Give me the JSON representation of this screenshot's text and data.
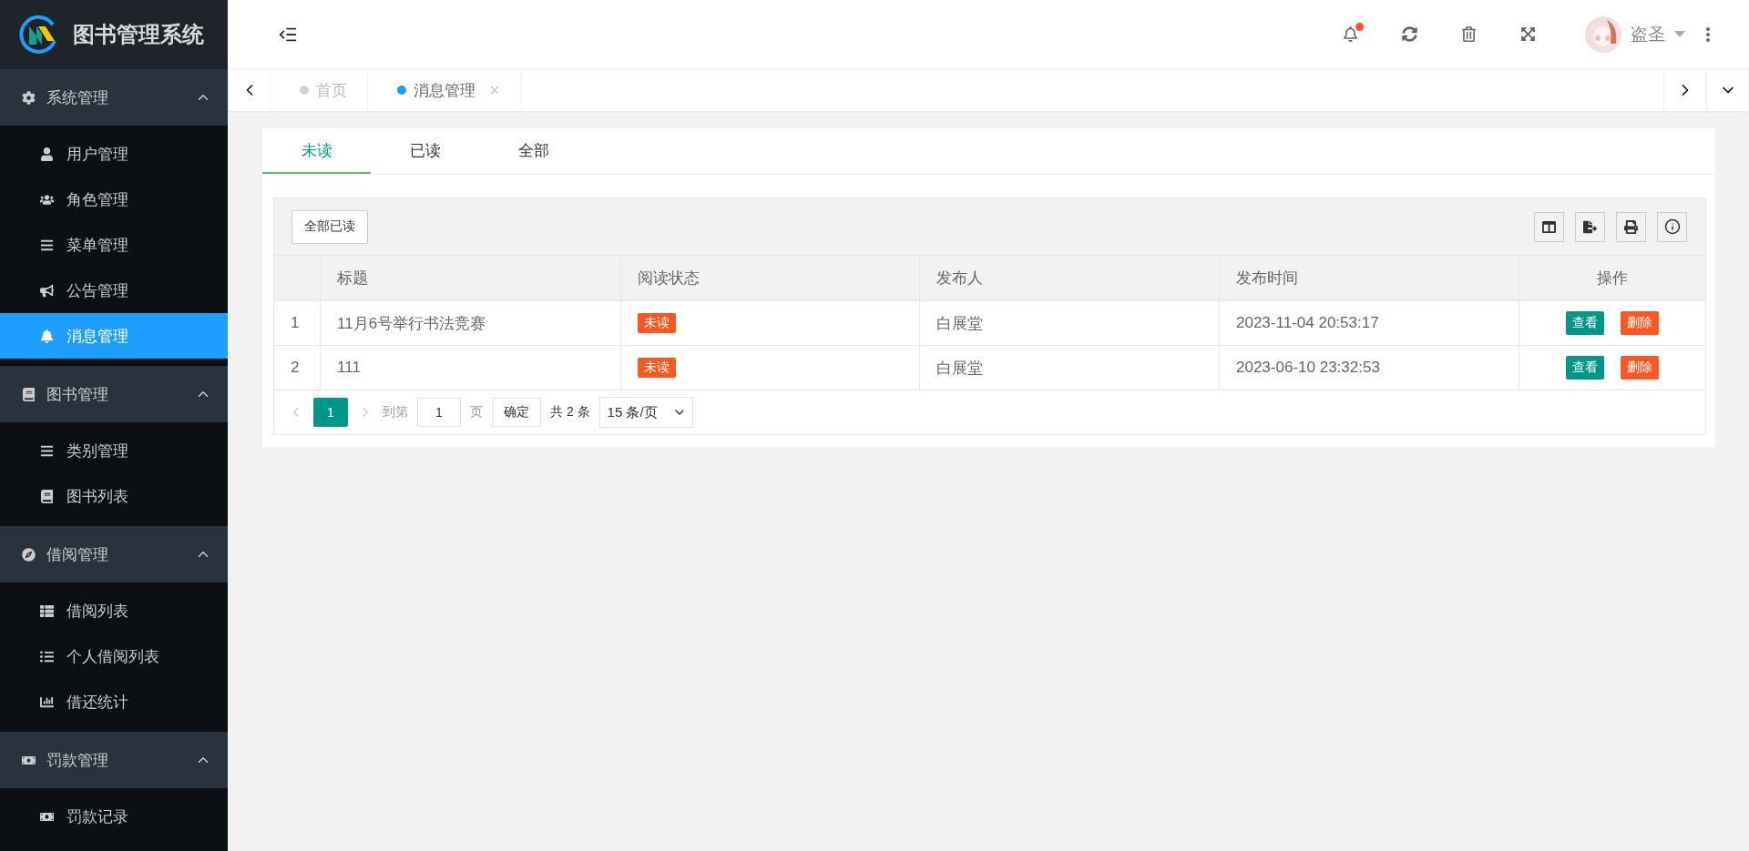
{
  "app": {
    "title": "图书管理系统"
  },
  "sidebar": {
    "groups": [
      {
        "label": "系统管理",
        "expanded": true,
        "items": [
          {
            "label": "用户管理",
            "selected": false
          },
          {
            "label": "角色管理",
            "selected": false
          },
          {
            "label": "菜单管理",
            "selected": false
          },
          {
            "label": "公告管理",
            "selected": false
          },
          {
            "label": "消息管理",
            "selected": true
          }
        ]
      },
      {
        "label": "图书管理",
        "expanded": true,
        "items": [
          {
            "label": "类别管理",
            "selected": false
          },
          {
            "label": "图书列表",
            "selected": false
          }
        ]
      },
      {
        "label": "借阅管理",
        "expanded": true,
        "items": [
          {
            "label": "借阅列表",
            "selected": false
          },
          {
            "label": "个人借阅列表",
            "selected": false
          },
          {
            "label": "借还统计",
            "selected": false
          }
        ]
      },
      {
        "label": "罚款管理",
        "expanded": true,
        "items": [
          {
            "label": "罚款记录",
            "selected": false
          }
        ]
      }
    ]
  },
  "header": {
    "notification_unread": true,
    "user": {
      "name": "盗圣"
    }
  },
  "page_tabs": [
    {
      "label": "首页",
      "selected": false,
      "closable": false
    },
    {
      "label": "消息管理",
      "selected": true,
      "closable": true
    }
  ],
  "message_tabs": [
    {
      "label": "未读",
      "selected": true
    },
    {
      "label": "已读",
      "selected": false
    },
    {
      "label": "全部",
      "selected": false
    }
  ],
  "toolbar": {
    "button": "全部已读"
  },
  "table": {
    "columns": [
      "标题",
      "阅读状态",
      "发布人",
      "发布时间",
      "操作"
    ],
    "rows": [
      {
        "index": "1",
        "title": "11月6号举行书法竞赛",
        "status": "未读",
        "publisher": "白展堂",
        "time": "2023-11-04 20:53:17",
        "actions": [
          {
            "label": "查看",
            "kind": "view"
          },
          {
            "label": "删除",
            "kind": "delete"
          }
        ]
      },
      {
        "index": "2",
        "title": "111",
        "status": "未读",
        "publisher": "白展堂",
        "time": "2023-06-10 23:32:53",
        "actions": [
          {
            "label": "查看",
            "kind": "view"
          },
          {
            "label": "删除",
            "kind": "delete"
          }
        ]
      }
    ]
  },
  "pagination": {
    "pages": [
      {
        "label": "1",
        "selected": true
      }
    ],
    "goto_label": "到第",
    "goto_value": "1",
    "page_unit": "页",
    "confirm": "确定",
    "total": "共 2 条",
    "page_size": "15 条/页"
  }
}
